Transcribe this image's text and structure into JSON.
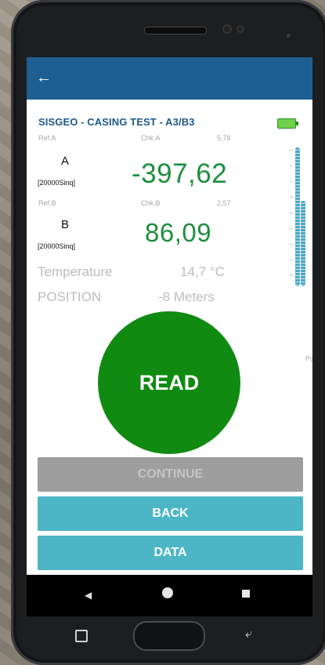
{
  "header": {
    "back_icon": "back-arrow-icon"
  },
  "title": "SISGEO - CASING TEST - A3/B3",
  "channel_a": {
    "ref_label": "Ref.A",
    "chk_label": "Chk.A",
    "chk_value": "5,78",
    "letter": "A",
    "sensor": "[20000Sinq]",
    "reading": "-397,62"
  },
  "channel_b": {
    "ref_label": "Ref.B",
    "chk_label": "Chk.B",
    "chk_value": "2,57",
    "letter": "B",
    "sensor": "[20000Sinq]",
    "reading": "86,09"
  },
  "temperature": {
    "label": "Temperature",
    "value": "14,7 °C"
  },
  "position": {
    "label": "POSITION",
    "value": "-8 Meters"
  },
  "gauge": {
    "label": "Pos.",
    "level_a_fraction": 0.97,
    "level_b_fraction": 0.6
  },
  "battery": {
    "icon": "battery-icon",
    "color": "#6fd04a"
  },
  "buttons": {
    "read": "READ",
    "continue": "CONTINUE",
    "back": "BACK",
    "data": "DATA"
  },
  "colors": {
    "appbar": "#1d5f93",
    "reading": "#1e8e3e",
    "read_button": "#108a10",
    "action_button": "#4cb6c6",
    "disabled_button": "#9e9e9e"
  },
  "navbar": {
    "back_icon": "nav-back-icon",
    "home_icon": "nav-home-icon",
    "recents_icon": "nav-recents-icon"
  }
}
